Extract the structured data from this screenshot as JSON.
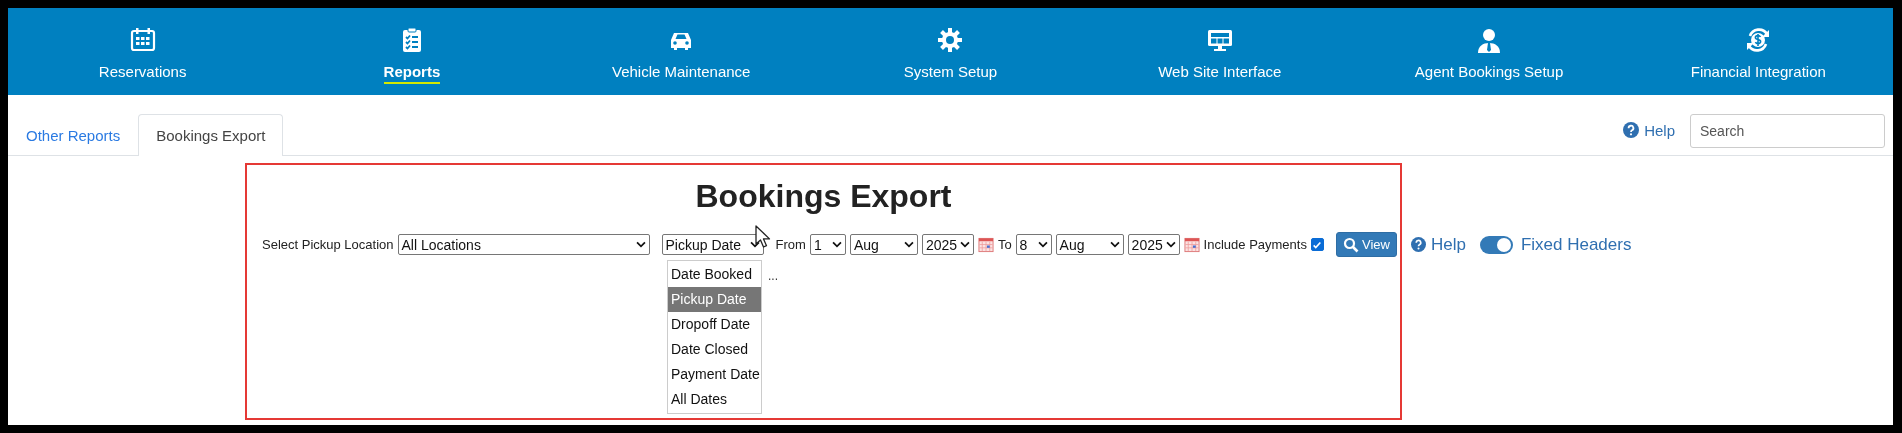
{
  "nav": {
    "items": [
      {
        "label": "Reservations",
        "kind": "calendar",
        "selected": false
      },
      {
        "label": "Reports",
        "kind": "clipboard",
        "selected": true
      },
      {
        "label": "Vehicle Maintenance",
        "kind": "car",
        "selected": false
      },
      {
        "label": "System Setup",
        "kind": "gear",
        "selected": false
      },
      {
        "label": "Web Site Interface",
        "kind": "monitor",
        "selected": false
      },
      {
        "label": "Agent Bookings Setup",
        "kind": "person",
        "selected": false
      },
      {
        "label": "Financial Integration",
        "kind": "money",
        "selected": false
      }
    ]
  },
  "tabs": [
    {
      "label": "Other Reports",
      "selected": false
    },
    {
      "label": "Bookings Export",
      "selected": true
    }
  ],
  "help_link": "Help",
  "search": {
    "placeholder": "Search"
  },
  "report": {
    "title": "Bookings Export",
    "location_label": "Select Pickup Location",
    "location": "All Locations",
    "date_type": {
      "value": "Pickup Date",
      "expanded": true,
      "options": [
        {
          "label": "Date Booked",
          "selected": false
        },
        {
          "label": "Pickup Date",
          "selected": true
        },
        {
          "label": "Dropoff Date",
          "selected": false
        },
        {
          "label": "Date Closed",
          "selected": false
        },
        {
          "label": "Payment Date",
          "selected": false
        },
        {
          "label": "All Dates",
          "selected": false
        }
      ]
    },
    "from_label": "From",
    "from": {
      "day": "1",
      "month": "Aug",
      "year": "2025"
    },
    "to_label": "To",
    "to": {
      "day": "8",
      "month": "Aug",
      "year": "2025"
    },
    "include_payments": {
      "label": "Include Payments",
      "checked": true
    },
    "view_button": "View",
    "help_link": "Help",
    "fixed_headers": {
      "label": "Fixed Headers",
      "on": true
    },
    "status": "..."
  }
}
